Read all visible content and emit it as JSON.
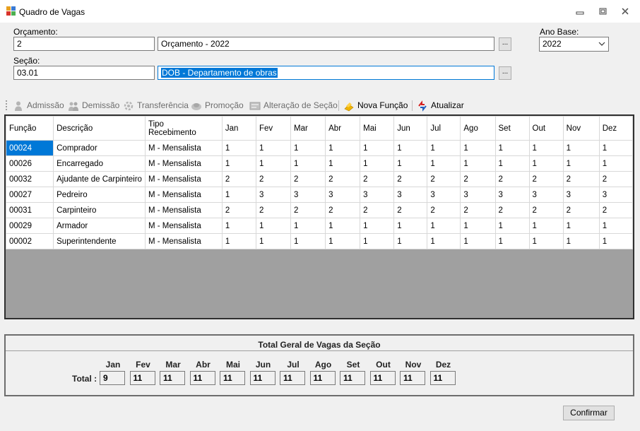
{
  "window": {
    "title": "Quadro de Vagas"
  },
  "form": {
    "orcamento_label": "Orçamento:",
    "orcamento_code": "2",
    "orcamento_desc": "Orçamento - 2022",
    "secao_label": "Seção:",
    "secao_code": "03.01",
    "secao_desc": "DOB - Departamento de obras",
    "ano_base_label": "Ano Base:",
    "ano_base_value": "2022",
    "browse_label": "..."
  },
  "toolbar": {
    "items": [
      {
        "label": "Admissão",
        "icon": "person-icon",
        "enabled": false
      },
      {
        "label": "Demissão",
        "icon": "people-icon",
        "enabled": false
      },
      {
        "label": "Transferência",
        "icon": "transfer-icon",
        "enabled": false
      },
      {
        "label": "Promoção",
        "icon": "promotion-icon",
        "enabled": false
      },
      {
        "label": "Alteração de Seção",
        "icon": "section-icon",
        "enabled": false
      },
      {
        "label": "Nova Função",
        "icon": "new-function-icon",
        "enabled": true
      },
      {
        "label": "Atualizar",
        "icon": "refresh-icon",
        "enabled": true
      }
    ]
  },
  "grid": {
    "columns": [
      "Função",
      "Descrição",
      "Tipo Recebimento",
      "Jan",
      "Fev",
      "Mar",
      "Abr",
      "Mai",
      "Jun",
      "Jul",
      "Ago",
      "Set",
      "Out",
      "Nov",
      "Dez"
    ],
    "rows": [
      [
        "00024",
        "Comprador",
        "M - Mensalista",
        "1",
        "1",
        "1",
        "1",
        "1",
        "1",
        "1",
        "1",
        "1",
        "1",
        "1",
        "1"
      ],
      [
        "00026",
        "Encarregado",
        "M - Mensalista",
        "1",
        "1",
        "1",
        "1",
        "1",
        "1",
        "1",
        "1",
        "1",
        "1",
        "1",
        "1"
      ],
      [
        "00032",
        "Ajudante de Carpinteiro",
        "M - Mensalista",
        "2",
        "2",
        "2",
        "2",
        "2",
        "2",
        "2",
        "2",
        "2",
        "2",
        "2",
        "2"
      ],
      [
        "00027",
        "Pedreiro",
        "M - Mensalista",
        "1",
        "3",
        "3",
        "3",
        "3",
        "3",
        "3",
        "3",
        "3",
        "3",
        "3",
        "3"
      ],
      [
        "00031",
        "Carpinteiro",
        "M - Mensalista",
        "2",
        "2",
        "2",
        "2",
        "2",
        "2",
        "2",
        "2",
        "2",
        "2",
        "2",
        "2"
      ],
      [
        "00029",
        "Armador",
        "M - Mensalista",
        "1",
        "1",
        "1",
        "1",
        "1",
        "1",
        "1",
        "1",
        "1",
        "1",
        "1",
        "1"
      ],
      [
        "00002",
        "Superintendente",
        "M - Mensalista",
        "1",
        "1",
        "1",
        "1",
        "1",
        "1",
        "1",
        "1",
        "1",
        "1",
        "1",
        "1"
      ]
    ]
  },
  "totals": {
    "title": "Total Geral de Vagas da Seção",
    "total_label": "Total :",
    "months": [
      "Jan",
      "Fev",
      "Mar",
      "Abr",
      "Mai",
      "Jun",
      "Jul",
      "Ago",
      "Set",
      "Out",
      "Nov",
      "Dez"
    ],
    "values": [
      "9",
      "11",
      "11",
      "11",
      "11",
      "11",
      "11",
      "11",
      "11",
      "11",
      "11",
      "11"
    ]
  },
  "buttons": {
    "confirm_label": "Confirmar"
  }
}
